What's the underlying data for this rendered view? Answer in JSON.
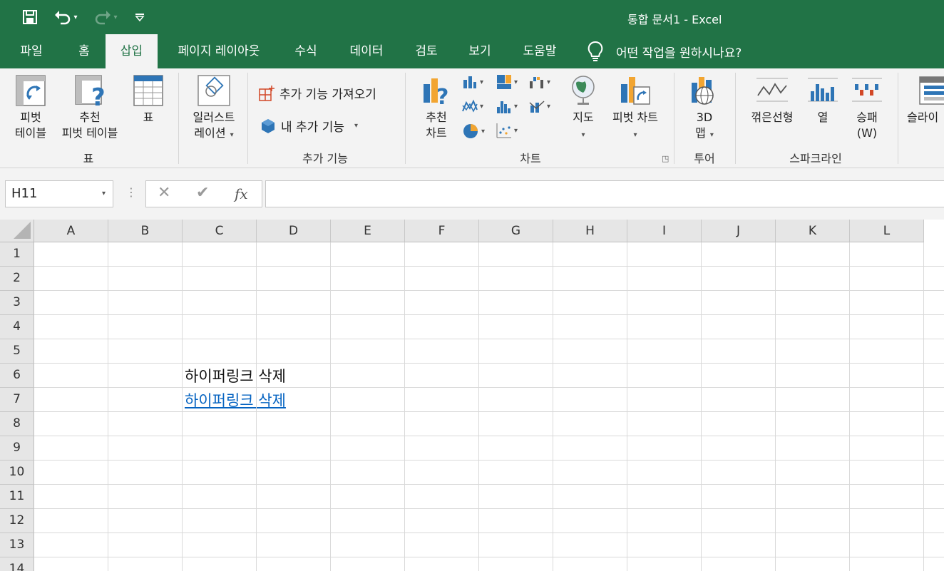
{
  "window": {
    "title": "통합 문서1  -  Excel"
  },
  "qat": {
    "save": "save-icon",
    "undo": "undo-icon",
    "redo": "redo-icon",
    "customize": "customize-qat-icon"
  },
  "tabs": [
    {
      "label": "파일"
    },
    {
      "label": "홈"
    },
    {
      "label": "삽입"
    },
    {
      "label": "페이지 레이아웃"
    },
    {
      "label": "수식"
    },
    {
      "label": "데이터"
    },
    {
      "label": "검토"
    },
    {
      "label": "보기"
    },
    {
      "label": "도움말"
    }
  ],
  "tell_me": {
    "text": "어떤 작업을 원하시나요?"
  },
  "ribbon": {
    "tables": {
      "label": "표",
      "pivot_l1": "피벗",
      "pivot_l2": "테이블",
      "rec_pivot_l1": "추천",
      "rec_pivot_l2": "피벗 테이블",
      "table": "표"
    },
    "illustrations": {
      "l1": "일러스트",
      "l2": "레이션"
    },
    "addins": {
      "label": "추가 기능",
      "get": "추가 기능 가져오기",
      "my": "내 추가 기능"
    },
    "charts": {
      "label": "차트",
      "rec_l1": "추천",
      "rec_l2": "차트",
      "maps": "지도",
      "pivot_chart": "피벗 차트"
    },
    "tours": {
      "label": "투어",
      "map3d_l1": "3D",
      "map3d_l2": "맵"
    },
    "sparklines": {
      "label": "스파크라인",
      "line": "꺾은선형",
      "column": "열",
      "winloss_l1": "승패",
      "winloss_l2": "(W)"
    },
    "filters": {
      "slicer": "슬라이"
    }
  },
  "formula_bar": {
    "name_box": "H11",
    "cancel": "✕",
    "enter": "✔",
    "fx": "fx",
    "content": ""
  },
  "columns": [
    "A",
    "B",
    "C",
    "D",
    "E",
    "F",
    "G",
    "H",
    "I",
    "J",
    "K",
    "L"
  ],
  "rows": [
    "1",
    "2",
    "3",
    "4",
    "5",
    "6",
    "7",
    "8",
    "9",
    "10",
    "11",
    "12",
    "13",
    "14"
  ],
  "cells": {
    "C6": "하이퍼링크 삭제",
    "C7": "하이퍼링크 삭제"
  },
  "colors": {
    "accent": "#217346",
    "link": "#0563c1"
  }
}
